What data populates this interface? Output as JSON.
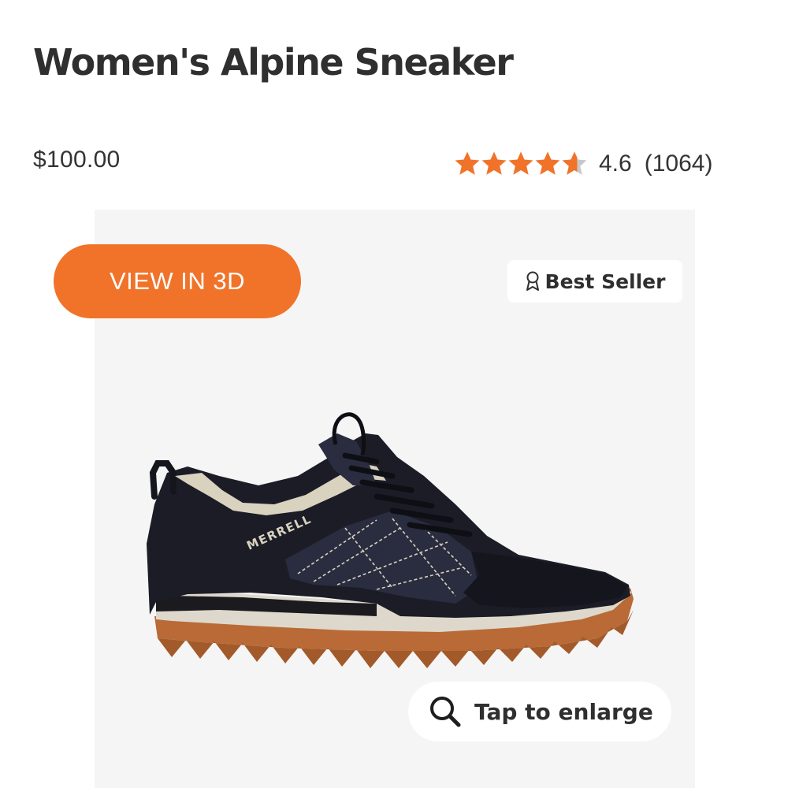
{
  "product": {
    "title": "Women's Alpine Sneaker",
    "price": "$100.00",
    "brand_on_shoe": "MERRELL"
  },
  "rating": {
    "value": "4.6",
    "count": "(1064)",
    "stars_filled": 4.6,
    "stars_max": 5,
    "star_color": "#f07329",
    "star_empty_color": "#c8c8c8"
  },
  "gallery": {
    "view_3d_label": "VIEW IN 3D",
    "badge_label": "Best Seller",
    "badge_icon": "award-ribbon-icon",
    "enlarge_label": "Tap to enlarge",
    "enlarge_icon": "magnifier-icon",
    "panel_color": "#f5f5f5",
    "accent_color": "#f07329"
  }
}
